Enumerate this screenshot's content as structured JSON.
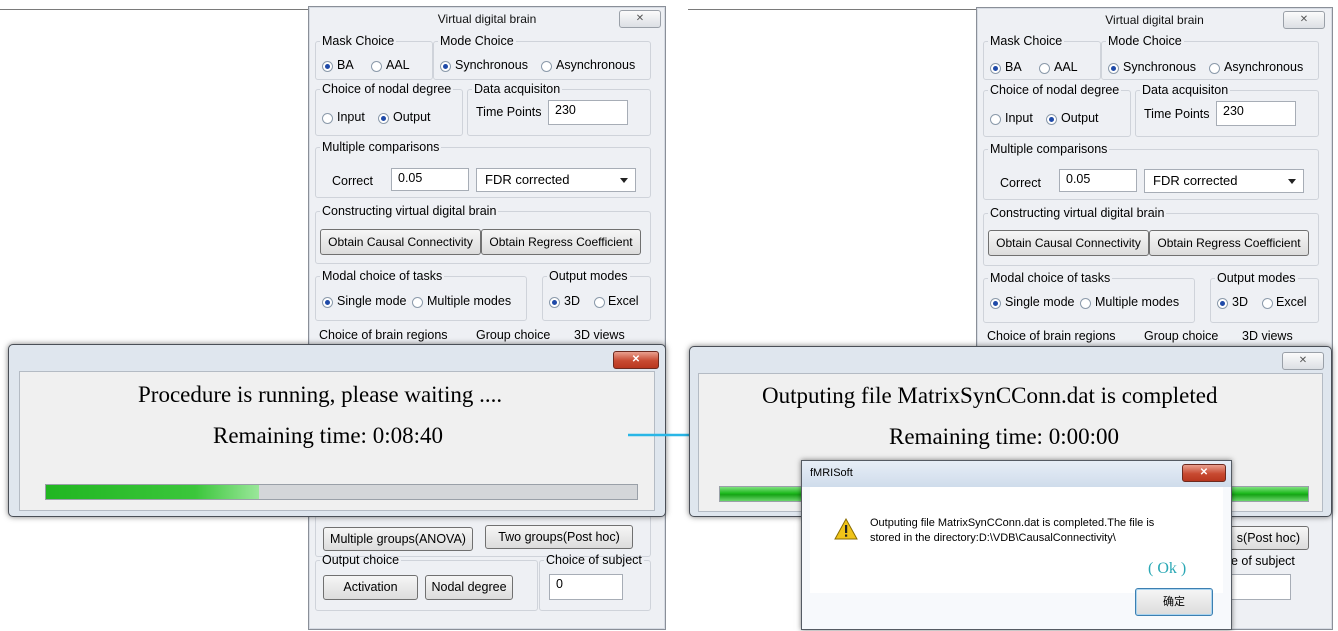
{
  "window": {
    "title": "Virtual  digital  brain",
    "close_icon": "✕"
  },
  "mask_choice": {
    "legend": "Mask Choice",
    "options": [
      "BA",
      "AAL"
    ],
    "selected": "BA"
  },
  "mode_choice": {
    "legend": "Mode Choice",
    "options": [
      "Synchronous",
      "Asynchronous"
    ],
    "selected": "Synchronous"
  },
  "nodal_degree": {
    "legend": "Choice of nodal degree",
    "options": [
      "Input",
      "Output"
    ],
    "selected": "Output"
  },
  "data_acquisition": {
    "legend": "Data acquisiton",
    "time_points_label": "Time Points",
    "time_points_value": "230"
  },
  "multiple_comparisons": {
    "legend": "Multiple comparisons",
    "correct_label": "Correct",
    "correct_value": "0.05",
    "method_selected": "FDR corrected"
  },
  "constructing": {
    "legend": "Constructing virtual digital brain",
    "causal_button": "Obtain  Causal Connectivity",
    "regress_button": "Obtain Regress Coefficient"
  },
  "modal_choice": {
    "legend": "Modal choice of tasks",
    "options": [
      "Single mode",
      "Multiple modes"
    ],
    "selected": "Single mode"
  },
  "output_modes": {
    "legend": "Output modes",
    "options": [
      "3D",
      "Excel"
    ],
    "selected": "3D"
  },
  "brain_regions_legend": "Choice of brain regions",
  "group_choice_legend": "Group choice",
  "views_legend": "3D views",
  "groups": {
    "anova_button": "Multiple groups(ANOVA)",
    "posthoc_button": "Two groups(Post hoc)",
    "posthoc_partial": "s(Post hoc)"
  },
  "output_choice": {
    "legend": "Output choice",
    "activation_button": "Activation",
    "nodal_button": "Nodal degree"
  },
  "subject_choice": {
    "legend": "Choice of subject",
    "partial_legend": "oice of subject",
    "value": "0"
  },
  "progress_running": {
    "message": "Procedure is running, please waiting ....",
    "remaining": "Remaining time: 0:08:40",
    "progress": 0.36
  },
  "progress_done": {
    "message": "Outputing file MatrixSynCConn.dat is completed",
    "remaining": "Remaining time: 0:00:00",
    "progress": 1.0
  },
  "message_box": {
    "title": "fMRISoft",
    "text_line1": "Outputing file MatrixSynCConn.dat is completed.The file is",
    "text_line2": "stored in the directory:D:\\VDB\\CausalConnectivity\\",
    "ok_hint": "( Ok )",
    "ok_button": "确定",
    "icon": "warning-icon"
  },
  "colors": {
    "progress_green": "#1db91d",
    "arrow": "#29b6e6",
    "hint_teal": "#2aa8b5"
  }
}
